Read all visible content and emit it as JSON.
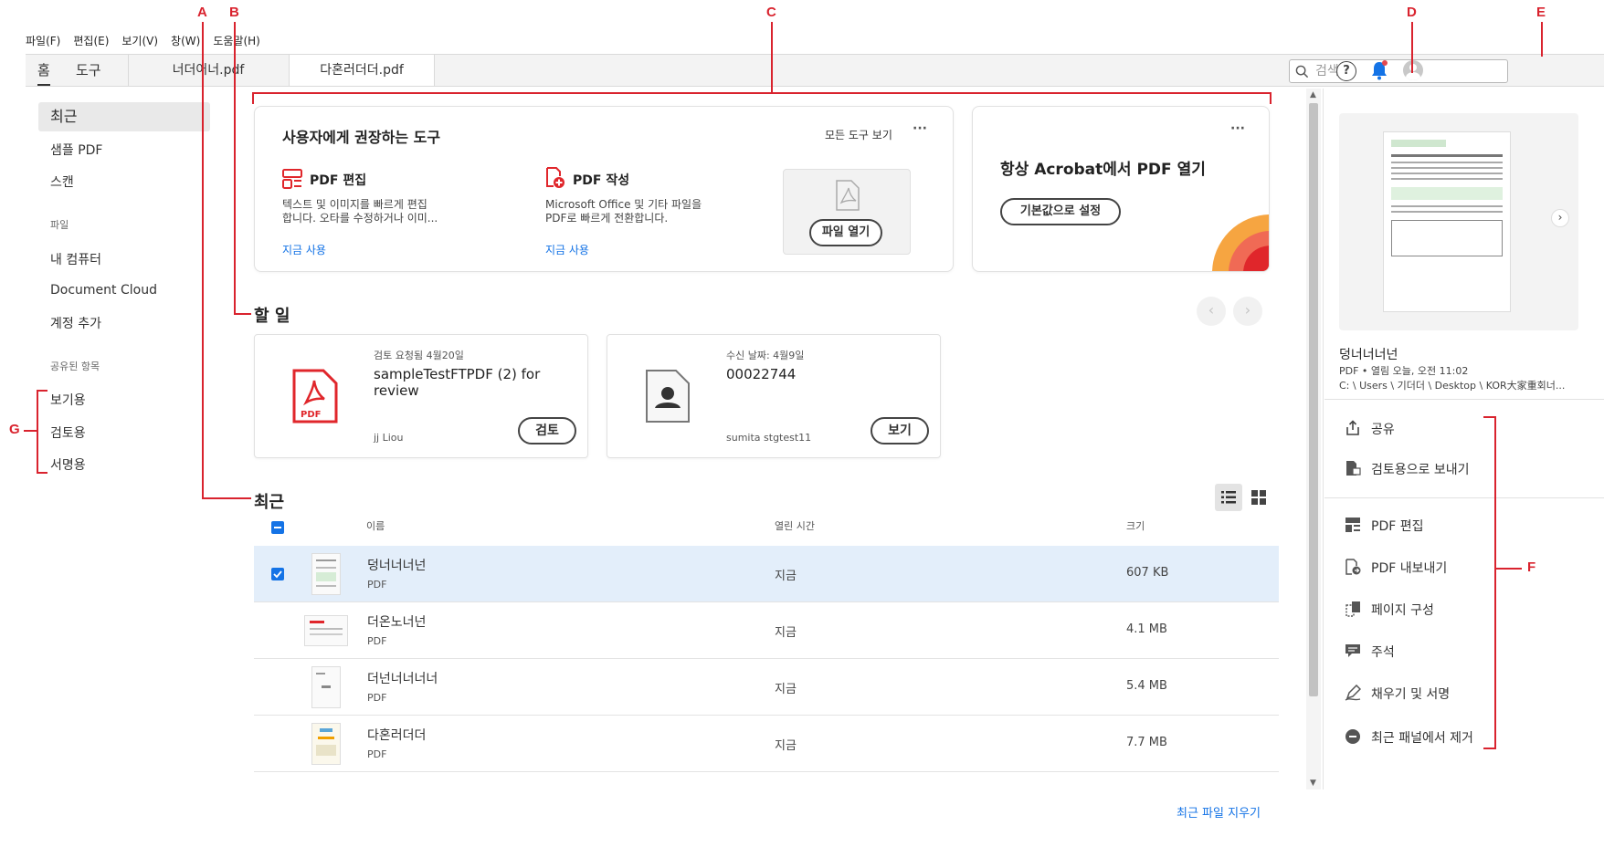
{
  "menu": [
    "파일(F)",
    "편집(E)",
    "보기(V)",
    "창(W)",
    "도움말(H)"
  ],
  "nav_tabs": {
    "home": "홈",
    "tools": "도구"
  },
  "doc_tabs": [
    "너더어너.pdf",
    "다혼러더더.pdf"
  ],
  "search": {
    "placeholder": "검색"
  },
  "sidebar": {
    "recent": "최근",
    "sample_pdf": "샘플 PDF",
    "scan": "스캔",
    "files_heading": "파일",
    "my_computer": "내 컴퓨터",
    "document_cloud": "Document Cloud",
    "add_account": "계정 추가",
    "shared_heading": "공유된 항목",
    "for_view": "보기용",
    "for_review": "검토용",
    "for_sign": "서명용"
  },
  "tools_card": {
    "title": "사용자에게 권장하는 도구",
    "all_tools": "모든 도구 보기",
    "more": "···",
    "edit_pdf": {
      "title": "PDF 편집",
      "desc1": "텍스트 및 이미지를 빠르게 편집",
      "desc2": "합니다. 오타를 수정하거나 이미...",
      "link": "지금 사용"
    },
    "create_pdf": {
      "title": "PDF 작성",
      "desc1": "Microsoft Office 및 기타 파일을",
      "desc2": "PDF로 빠르게 전환합니다.",
      "link": "지금 사용"
    },
    "open_file": "파일 열기"
  },
  "acrobat_card": {
    "title": "항상 Acrobat에서 PDF 열기",
    "button": "기본값으로 설정",
    "more": "···"
  },
  "todo": {
    "heading": "할 일",
    "items": [
      {
        "meta": "검토 요청됨 4월20일",
        "name": "sampleTestFTPDF (2) for review",
        "user": "jj Liou",
        "button": "검토",
        "icon_label": "PDF"
      },
      {
        "meta": "수신 날짜: 4월9일",
        "name": "00022744",
        "user": "sumita stgtest11",
        "button": "보기"
      }
    ]
  },
  "recent": {
    "heading": "최근",
    "columns": {
      "name": "이름",
      "opened": "열린 시간",
      "size": "크기"
    },
    "rows": [
      {
        "name": "덩너너너넌",
        "type": "PDF",
        "time": "지금",
        "size": "607 KB",
        "selected": true
      },
      {
        "name": "더온노너넌",
        "type": "PDF",
        "time": "지금",
        "size": "4.1 MB",
        "selected": false
      },
      {
        "name": "더넌너너너너",
        "type": "PDF",
        "time": "지금",
        "size": "5.4 MB",
        "selected": false
      },
      {
        "name": "다혼러더더",
        "type": "PDF",
        "time": "지금",
        "size": "7.7 MB",
        "selected": false
      }
    ],
    "clear": "최근 파일 지우기"
  },
  "right_panel": {
    "file_name": "덩너너너넌",
    "file_meta": "PDF • 열림 오늘, 오전 11:02",
    "file_path": "C: \\ Users \\ 기더더 \\ Desktop \\ KOR大家重회너...",
    "actions": [
      "공유",
      "검토용으로 보내기",
      "PDF 편집",
      "PDF 내보내기",
      "페이지 구성",
      "주석",
      "채우기 및 서명",
      "최근 패널에서 제거"
    ]
  },
  "annotations": [
    "A",
    "B",
    "C",
    "D",
    "E",
    "F",
    "G"
  ],
  "colors": {
    "accent": "#1473e6",
    "annotation": "#d9232e",
    "selected_row": "#e3eefa",
    "pdf_red": "#e0262b"
  }
}
